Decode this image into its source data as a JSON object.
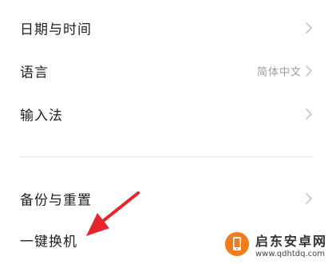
{
  "settings": {
    "items": [
      {
        "label": "日期与时间",
        "value": ""
      },
      {
        "label": "语言",
        "value": "简体中文"
      },
      {
        "label": "输入法",
        "value": ""
      },
      {
        "label": "备份与重置",
        "value": ""
      },
      {
        "label": "一键换机",
        "value": ""
      }
    ]
  },
  "colors": {
    "arrow": "#e8242b",
    "chevron": "#c4c4c4",
    "watermark_logo": "#f07c1e"
  },
  "watermark": {
    "name": "启东安卓网",
    "url": "www.qdhtdq.com"
  }
}
